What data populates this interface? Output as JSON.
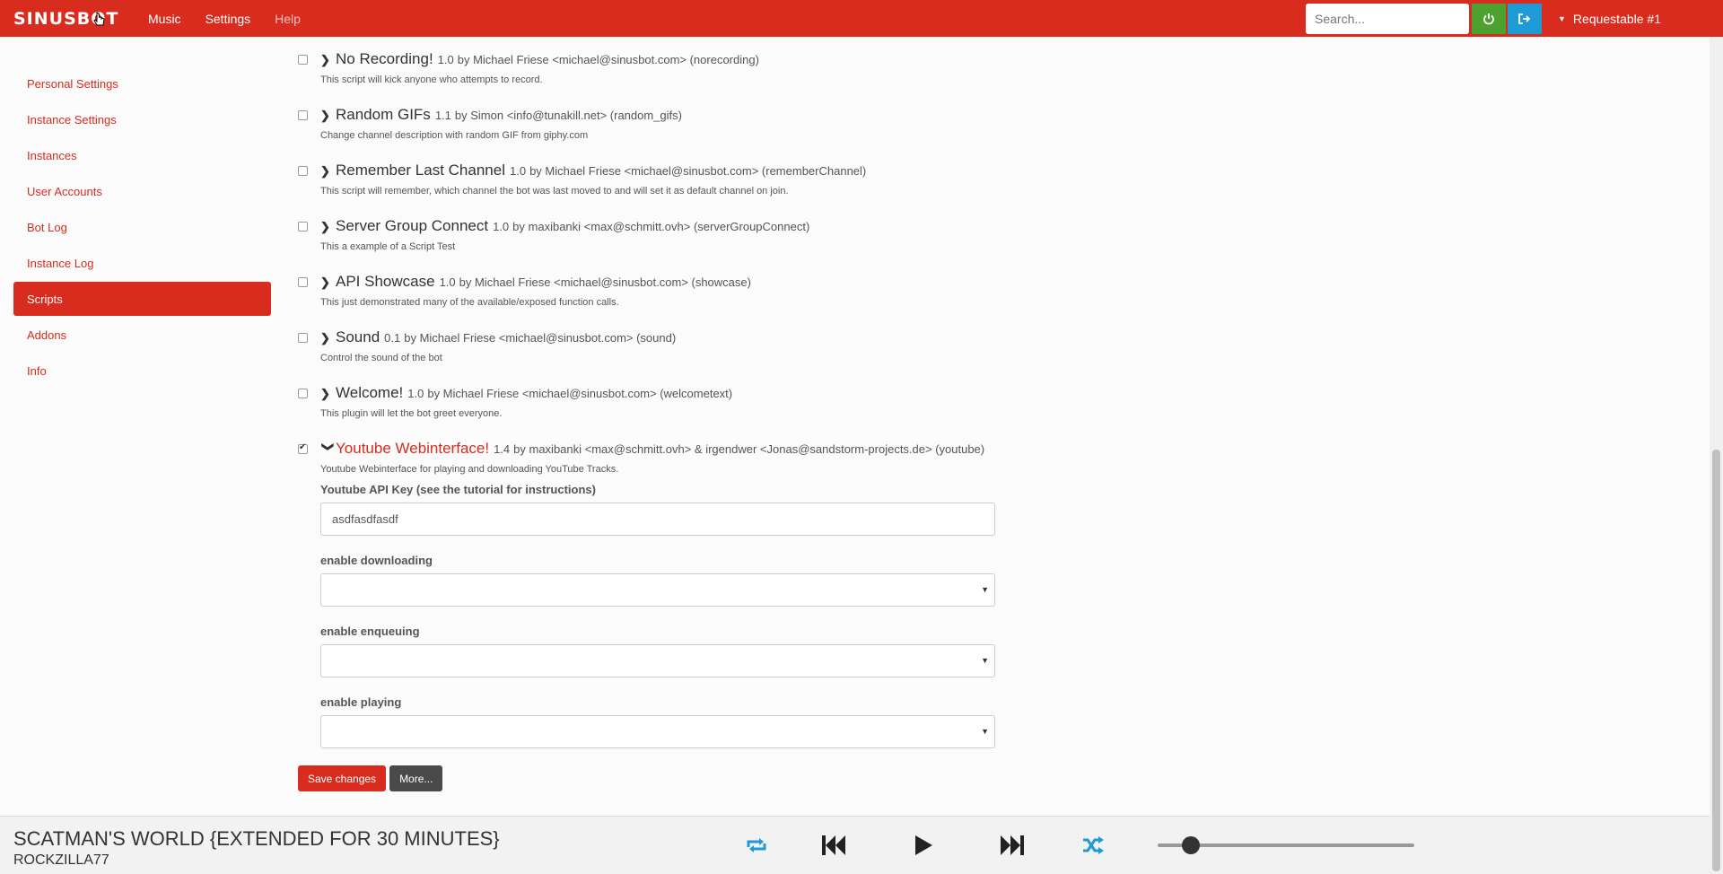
{
  "brand": "SINUSBOT",
  "nav": {
    "music": "Music",
    "settings": "Settings",
    "help": "Help"
  },
  "search": {
    "placeholder": "Search..."
  },
  "instance": {
    "label": "Requestable #1"
  },
  "sidebar": {
    "items": [
      {
        "label": "Personal Settings",
        "active": false
      },
      {
        "label": "Instance Settings",
        "active": false
      },
      {
        "label": "Instances",
        "active": false
      },
      {
        "label": "User Accounts",
        "active": false
      },
      {
        "label": "Bot Log",
        "active": false
      },
      {
        "label": "Instance Log",
        "active": false
      },
      {
        "label": "Scripts",
        "active": true
      },
      {
        "label": "Addons",
        "active": false
      },
      {
        "label": "Info",
        "active": false
      }
    ]
  },
  "scripts": [
    {
      "name": "No Recording!",
      "version": "1.0",
      "meta": "by Michael Friese <michael@sinusbot.com> (norecording)",
      "desc": "This script will kick anyone who attempts to record.",
      "checked": false
    },
    {
      "name": "Random GIFs",
      "version": "1.1",
      "meta": "by Simon <info@tunakill.net> (random_gifs)",
      "desc": "Change channel description with random GIF from giphy.com",
      "checked": false
    },
    {
      "name": "Remember Last Channel",
      "version": "1.0",
      "meta": "by Michael Friese <michael@sinusbot.com> (rememberChannel)",
      "desc": "This script will remember, which channel the bot was last moved to and will set it as default channel on join.",
      "checked": false
    },
    {
      "name": "Server Group Connect",
      "version": "1.0",
      "meta": "by maxibanki <max@schmitt.ovh> (serverGroupConnect)",
      "desc": "This a example of a Script Test",
      "checked": false
    },
    {
      "name": "API Showcase",
      "version": "1.0",
      "meta": "by Michael Friese <michael@sinusbot.com> (showcase)",
      "desc": "This just demonstrated many of the available/exposed function calls.",
      "checked": false
    },
    {
      "name": "Sound",
      "version": "0.1",
      "meta": "by Michael Friese <michael@sinusbot.com> (sound)",
      "desc": "Control the sound of the bot",
      "checked": false
    },
    {
      "name": "Welcome!",
      "version": "1.0",
      "meta": "by Michael Friese <michael@sinusbot.com> (welcometext)",
      "desc": "This plugin will let the bot greet everyone.",
      "checked": false
    },
    {
      "name": "Youtube Webinterface!",
      "version": "1.4",
      "meta": "by maxibanki <max@schmitt.ovh> & irgendwer <Jonas@sandstorm-projects.de> (youtube)",
      "desc": "Youtube Webinterface for playing and downloading YouTube Tracks.",
      "checked": true
    }
  ],
  "config": {
    "api_key_label": "Youtube API Key (see the tutorial for instructions)",
    "api_key_value": "asdfasdfasdf",
    "downloading_label": "enable downloading",
    "enqueuing_label": "enable enqueuing",
    "playing_label": "enable playing"
  },
  "actions": {
    "save": "Save changes",
    "more": "More..."
  },
  "player": {
    "title": "SCATMAN'S WORLD {EXTENDED FOR 30 MINUTES}",
    "artist": "ROCKZILLA77",
    "volume_fraction": 0.13
  },
  "colors": {
    "accent": "#d82c1e",
    "power": "#4da12f",
    "logout": "#1e9ad6"
  }
}
